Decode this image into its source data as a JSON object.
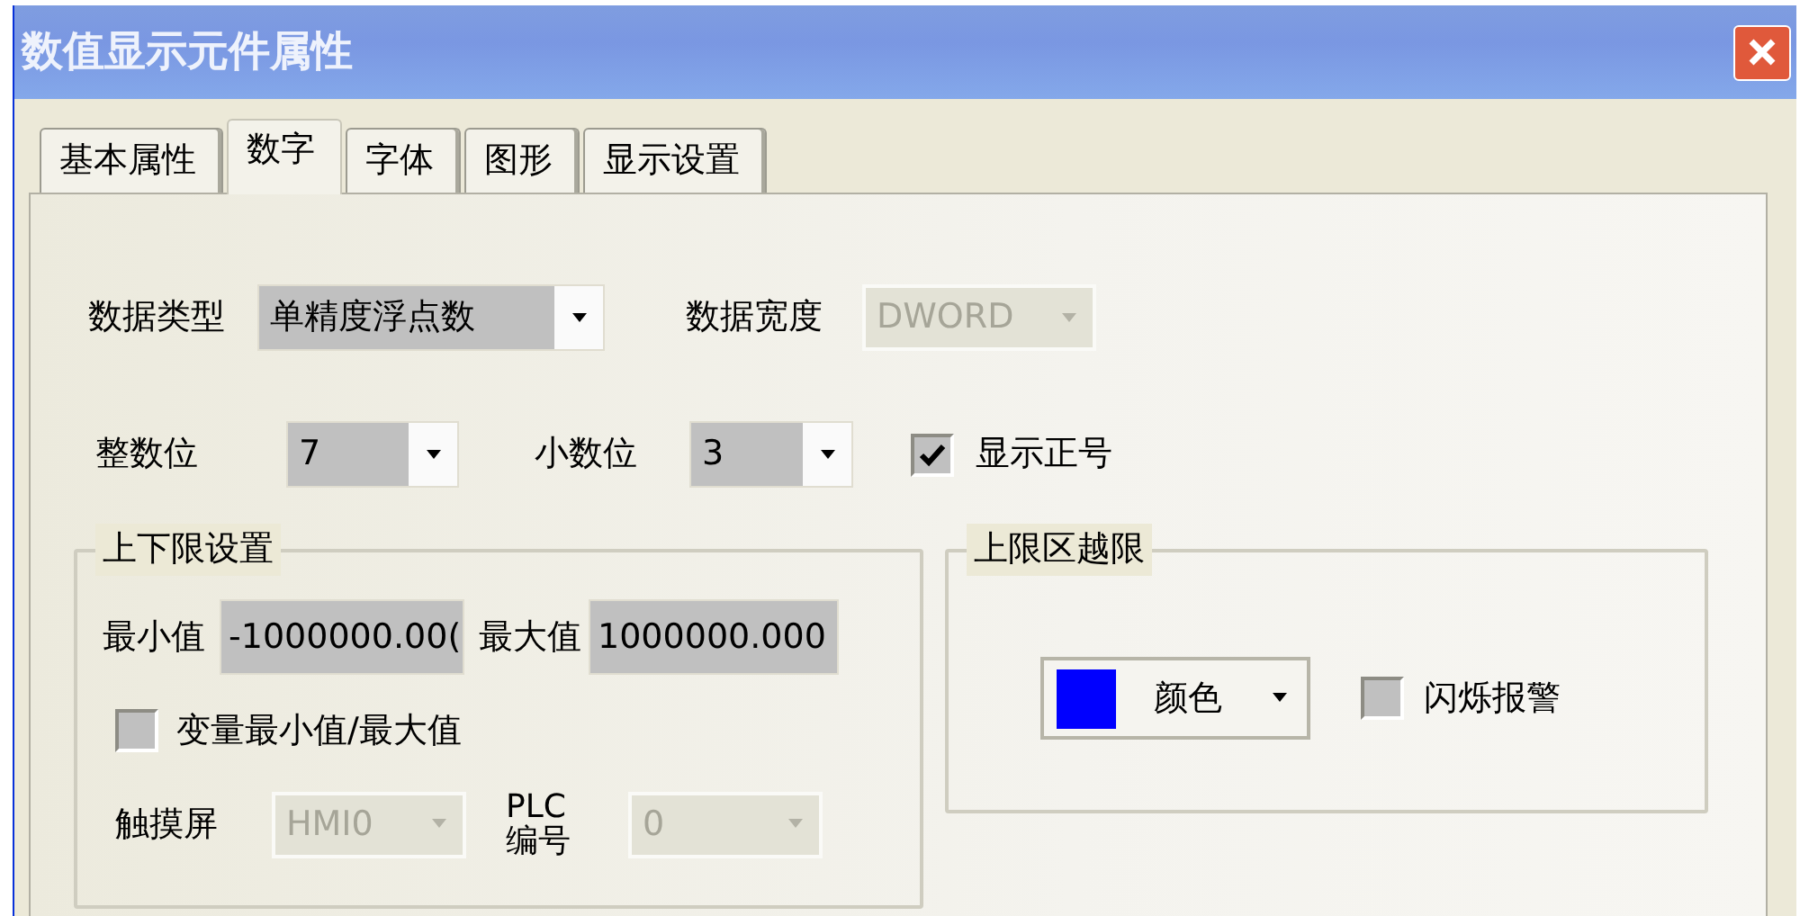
{
  "window": {
    "title": "数值显示元件属性"
  },
  "tabs": [
    {
      "label": "基本属性",
      "selected": false
    },
    {
      "label": "数字",
      "selected": true
    },
    {
      "label": "字体",
      "selected": false
    },
    {
      "label": "图形",
      "selected": false
    },
    {
      "label": "显示设置",
      "selected": false
    }
  ],
  "data_type": {
    "label": "数据类型",
    "value": "单精度浮点数",
    "disabled": false
  },
  "data_width": {
    "label": "数据宽度",
    "value": "DWORD",
    "disabled": true
  },
  "integer_digits": {
    "label": "整数位",
    "value": "7",
    "disabled": false
  },
  "decimal_digits": {
    "label": "小数位",
    "value": "3",
    "disabled": false
  },
  "show_plus_sign": {
    "label": "显示正号",
    "checked": true
  },
  "limits": {
    "title": "上下限设置",
    "min": {
      "label": "最小值",
      "value": "-1000000.00("
    },
    "max": {
      "label": "最大值",
      "value": "1000000.000"
    },
    "variable_limits": {
      "label": "变量最小值/最大值",
      "checked": false
    },
    "hmi": {
      "label": "触摸屏",
      "value": "HMI0",
      "disabled": true
    },
    "plc": {
      "label": "PLC 编号",
      "value": "0",
      "disabled": true
    }
  },
  "upper_limit": {
    "title": "上限区越限",
    "color": {
      "label": "颜色",
      "color": "#0000ff"
    },
    "flash_alarm": {
      "label": "闪烁报警",
      "checked": false
    }
  }
}
